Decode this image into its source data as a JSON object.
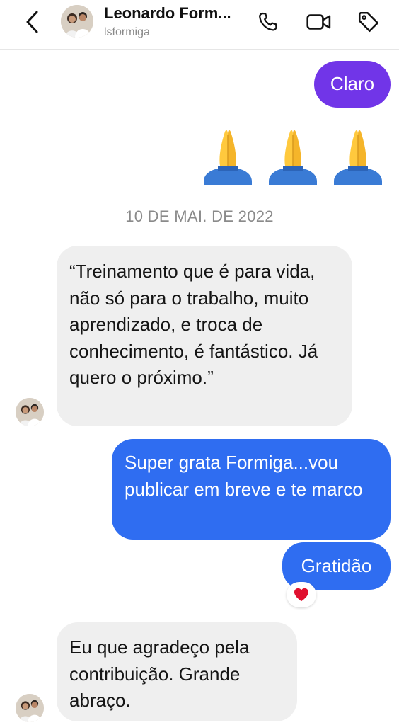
{
  "header": {
    "contact_name": "Leonardo Form...",
    "username": "lsformiga",
    "back_icon": "chevron-left-icon",
    "call_icon": "phone-icon",
    "video_icon": "video-camera-icon",
    "tag_icon": "tag-icon"
  },
  "messages": {
    "claro": "Claro",
    "emoji_reaction_icon": "folded-hands-emoji",
    "date_divider": "10 DE MAI. DE 2022",
    "quote": "“Treinamento que é para vida, não só para o trabalho, muito aprendizado, e troca de conhecimento, é fantástico. Já quero o próximo.”",
    "super_grata": "Super grata Formiga...vou publicar em breve e te marco",
    "gratidao": "Gratidão",
    "heart_reaction": "❤️",
    "eu_que": "Eu que agradeço pela contribuição. Grande abraço."
  },
  "colors": {
    "outgoing_blue": "#2f6df1",
    "outgoing_purple": "#7135e8",
    "incoming_gray": "#efefef"
  }
}
